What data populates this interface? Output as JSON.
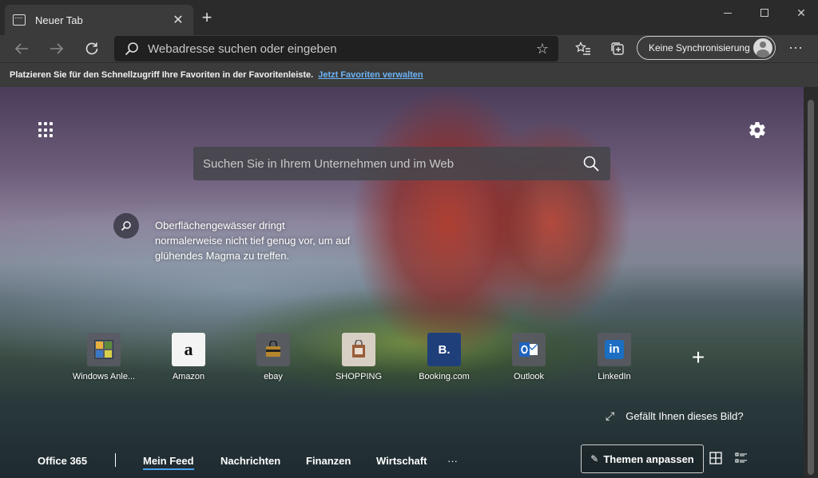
{
  "window": {
    "tab_title": "Neuer Tab",
    "tab_close": "✕",
    "new_tab": "+",
    "close": "✕"
  },
  "toolbar": {
    "address_placeholder": "Webadresse suchen oder eingeben",
    "sync_label": "Keine Synchronisierung",
    "more": "···"
  },
  "favbar": {
    "text": "Platzieren Sie für den Schnellzugriff Ihre Favoriten in der Favoritenleiste.",
    "link": "Jetzt Favoriten verwalten"
  },
  "ntp": {
    "search_placeholder": "Suchen Sie in Ihrem Unternehmen und im Web",
    "fact": "Oberflächengewässer dringt normalerweise nicht tief genug vor, um auf glühendes Magma zu treffen.",
    "like_picture": "Gefällt Ihnen dieses Bild?",
    "quicklinks": [
      {
        "label": "Windows Anle..."
      },
      {
        "label": "Amazon",
        "glyph": "a"
      },
      {
        "label": "ebay"
      },
      {
        "label": "SHOPPING"
      },
      {
        "label": "Booking.com",
        "glyph": "B."
      },
      {
        "label": "Outlook"
      },
      {
        "label": "LinkedIn",
        "glyph": "in"
      }
    ],
    "add_link": "+",
    "feed": {
      "office": "Office 365",
      "tabs": [
        "Mein Feed",
        "Nachrichten",
        "Finanzen",
        "Wirtschaft"
      ],
      "more": "···",
      "themes_button": "Themen anpassen"
    }
  },
  "colors": {
    "accent_link": "#6cb4f7",
    "active_tab_underline": "#4aa3f0"
  }
}
